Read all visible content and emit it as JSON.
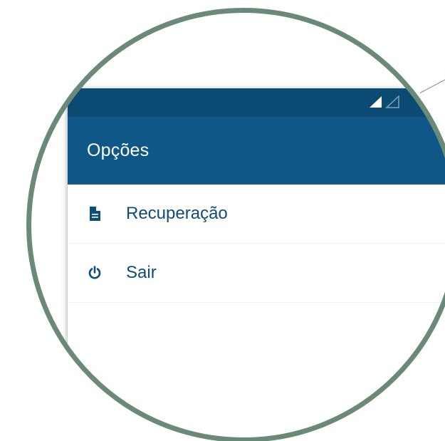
{
  "status_bar": {
    "icons": [
      "signal-icon",
      "signal-empty-icon"
    ]
  },
  "app_bar": {
    "title": "Opções"
  },
  "menu": {
    "items": [
      {
        "label": "Recuperação",
        "icon": "document-icon"
      },
      {
        "label": "Sair",
        "icon": "power-icon"
      }
    ]
  },
  "colors": {
    "status_bar": "#0b4a72",
    "app_bar": "#0e5787",
    "menu_text": "#0e4d78",
    "lens_border": "#6a8a77"
  }
}
